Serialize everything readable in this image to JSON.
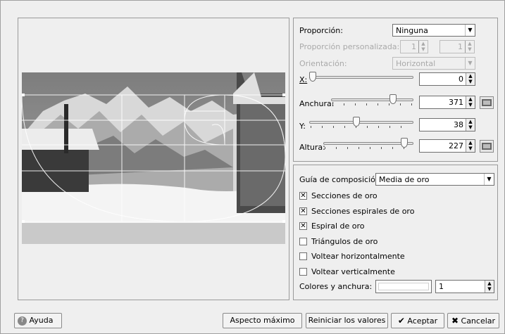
{
  "right_panel": {
    "proporcion_label": "Proporción:",
    "proporcion_value": "Ninguna",
    "custom_label": "Proporción personalizada:",
    "custom_a": "1",
    "custom_b": "1",
    "orient_label": "Orientación:",
    "orient_value": "Horizontal",
    "x_label": "X:",
    "x_value": "0",
    "x_slider": 0.0,
    "anchura_label": "Anchura:",
    "anchura_value": "371",
    "anchura_slider": 0.78,
    "y_label": "Y:",
    "y_value": "38",
    "y_slider": 0.45,
    "altura_label": "Altura:",
    "altura_value": "227",
    "altura_slider": 0.93
  },
  "composition": {
    "guide_label": "Guía de composición:",
    "guide_value": "Media de oro",
    "options": [
      {
        "label": "Secciones de oro",
        "checked": true
      },
      {
        "label": "Secciones espirales de oro",
        "checked": true
      },
      {
        "label": "Espiral de oro",
        "checked": true
      },
      {
        "label": "Triángulos de oro",
        "checked": false
      },
      {
        "label": "Voltear horizontalmente",
        "checked": false
      },
      {
        "label": "Voltear verticalmente",
        "checked": false
      }
    ],
    "colors_label": "Colores y anchura:",
    "width_value": "1"
  },
  "buttons": {
    "help": "Ayuda",
    "max_aspect": "Aspecto máximo",
    "reset": "Reiniciar los valores",
    "accept": "Aceptar",
    "cancel": "Cancelar"
  },
  "colors": {
    "guide_line": "#ffffff",
    "panel_bg": "#efefef"
  }
}
